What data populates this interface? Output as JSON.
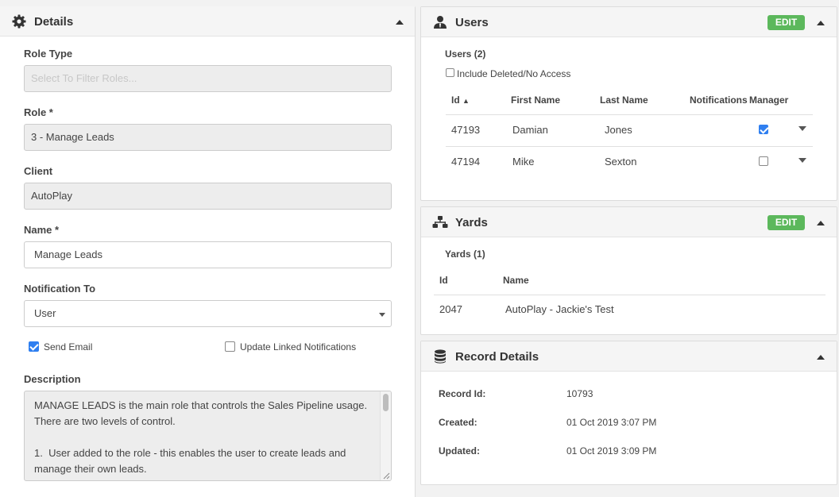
{
  "details": {
    "title": "Details",
    "role_type": {
      "label": "Role Type",
      "placeholder": "Select To Filter Roles..."
    },
    "role": {
      "label": "Role *",
      "value": "3 - Manage Leads"
    },
    "client": {
      "label": "Client",
      "value": "AutoPlay"
    },
    "name": {
      "label": "Name *",
      "value": "Manage Leads"
    },
    "notification_to": {
      "label": "Notification To",
      "value": "User"
    },
    "send_email": {
      "label": "Send Email",
      "checked": true
    },
    "update_linked": {
      "label": "Update Linked Notifications",
      "checked": false
    },
    "description": {
      "label": "Description",
      "lines": [
        "MANAGE LEADS is the main role that controls the Sales Pipeline usage.",
        "There are two levels of control.",
        "",
        "1.  User added to the role - this enables the user to create leads and",
        "manage their own leads."
      ]
    }
  },
  "users": {
    "title": "Users",
    "edit_label": "EDIT",
    "subtitle": "Users (2)",
    "include_deleted_label": "Include Deleted/No Access",
    "columns": {
      "id": "Id",
      "sort_arrow": "▲",
      "first": "First Name",
      "last": "Last Name",
      "notifications": "Notifications",
      "manager": "Manager"
    },
    "rows": [
      {
        "id": "47193",
        "first": "Damian",
        "last": "Jones",
        "manager": true
      },
      {
        "id": "47194",
        "first": "Mike",
        "last": "Sexton",
        "manager": false
      }
    ]
  },
  "yards": {
    "title": "Yards",
    "edit_label": "EDIT",
    "subtitle": "Yards (1)",
    "columns": {
      "id": "Id",
      "name": "Name"
    },
    "rows": [
      {
        "id": "2047",
        "name": "AutoPlay - Jackie's Test"
      }
    ]
  },
  "record": {
    "title": "Record Details",
    "record_id_label": "Record Id:",
    "record_id": "10793",
    "created_label": "Created:",
    "created": "01 Oct 2019 3:07 PM",
    "updated_label": "Updated:",
    "updated": "01 Oct 2019 3:09 PM"
  },
  "colors": {
    "accent_green": "#5cb85c",
    "checkbox_blue": "#2f7ff0"
  },
  "icons": {
    "details": "gear-icon",
    "users": "user-icon",
    "yards": "yards-icon",
    "record": "database-icon",
    "collapse": "caret-up-icon",
    "row_menu": "caret-down-icon"
  }
}
